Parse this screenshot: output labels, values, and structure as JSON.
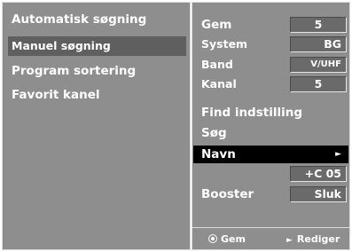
{
  "left_menu": {
    "items": [
      {
        "label": "Automatisk søgning"
      },
      {
        "label": "Manuel søgning"
      },
      {
        "label": "Program sortering"
      },
      {
        "label": "Favorit kanel"
      }
    ]
  },
  "settings": {
    "gem": {
      "label": "Gem",
      "value": "5"
    },
    "system": {
      "label": "System",
      "value": "BG"
    },
    "band": {
      "label": "Band",
      "value": "V/UHF"
    },
    "kanal": {
      "label": "Kanal",
      "value": "5"
    },
    "find": {
      "label": "Find indstilling"
    },
    "sog": {
      "label": "Søg"
    },
    "navn": {
      "label": "Navn",
      "arrow": "►",
      "value": "+C 05"
    },
    "booster": {
      "label": "Booster",
      "value": "Sluk"
    }
  },
  "footer": {
    "gem_label": "Gem",
    "rediger_icon": "►",
    "rediger_label": "Rediger"
  }
}
